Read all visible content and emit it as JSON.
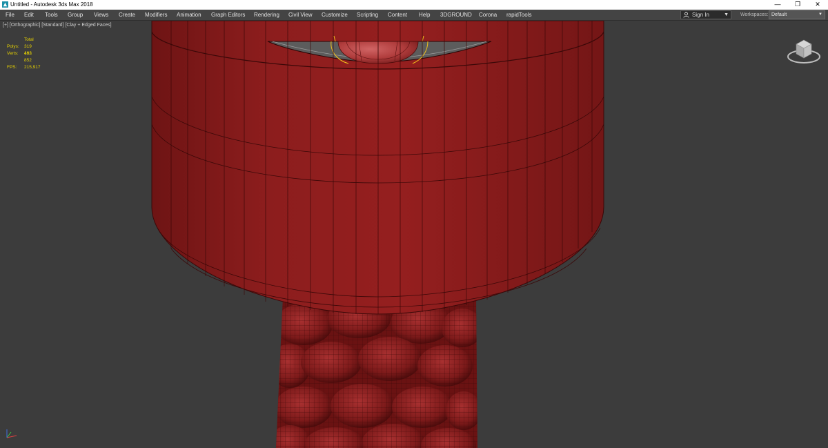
{
  "window": {
    "title": "Untitled - Autodesk 3ds Max 2018",
    "minimize_glyph": "—",
    "restore_glyph": "❐",
    "close_glyph": "✕"
  },
  "menu": {
    "items": [
      "File",
      "Edit",
      "Tools",
      "Group",
      "Views",
      "Create",
      "Modifiers",
      "Animation",
      "Graph Editors",
      "Rendering",
      "Civil View",
      "Customize",
      "Scripting",
      "Content",
      "Help",
      "3DGROUND",
      "Corona",
      "rapidTools"
    ],
    "sign_in": "Sign In",
    "workspaces_label": "Workspaces:",
    "workspace_value": "Default"
  },
  "viewport": {
    "label": "[+] [Orthographic] [Standard] [Clay + Edged Faces]",
    "stats": {
      "header": "Total",
      "polys_label": "Polys:",
      "polys_value": "319 482",
      "verts_label": "Verts:",
      "verts_value": "163 852",
      "fps_label": "FPS:",
      "fps_value": "215,917"
    },
    "icons": [
      "viewcube-icon",
      "axis-tripod-icon"
    ]
  },
  "colors": {
    "menubar_bg": "#444444",
    "viewport_bg": "#3c3c3c",
    "stats_text": "#e6d100",
    "model_clay": "#8e1e1e",
    "wireframe": "#3a0808"
  }
}
